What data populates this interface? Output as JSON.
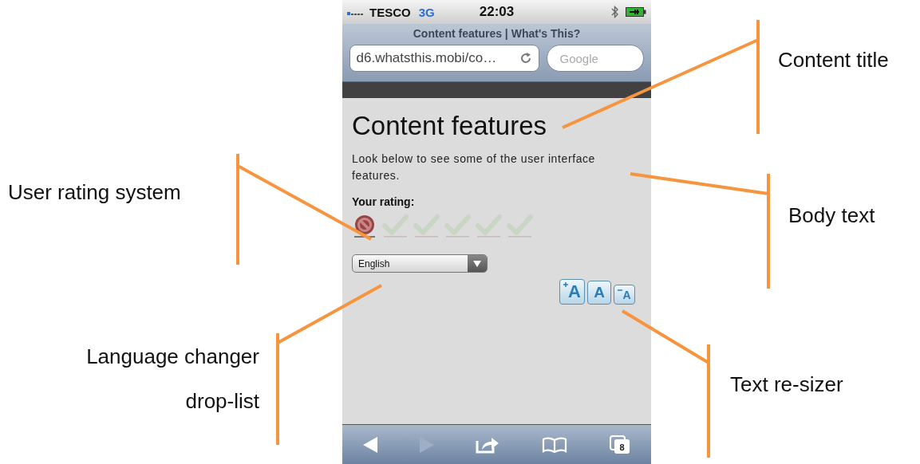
{
  "status_bar": {
    "carrier": "TESCO",
    "network": "3G",
    "time": "22:03"
  },
  "browser": {
    "page_title": "Content features | What's This?",
    "address": "d6.whatsthis.mobi/co…",
    "search_placeholder": "Google"
  },
  "page": {
    "title": "Content features",
    "body": "Look below to see some of the user interface features.",
    "rating_label": "Your rating:",
    "rating": {
      "stars": 0
    },
    "language": "English",
    "text_sizes": [
      {
        "kind": "increase",
        "label": "A"
      },
      {
        "kind": "normal",
        "label": "A"
      },
      {
        "kind": "decrease",
        "label": "A"
      }
    ]
  },
  "toolbar": {
    "back": {
      "disabled": false
    },
    "forward": {
      "disabled": true
    },
    "tab_count": "8"
  },
  "annotations": [
    {
      "text": "Content title"
    },
    {
      "text": "User rating system"
    },
    {
      "text": "Body text"
    },
    {
      "text": "Language changer drop-list"
    },
    {
      "text": "Text re-sizer"
    }
  ]
}
